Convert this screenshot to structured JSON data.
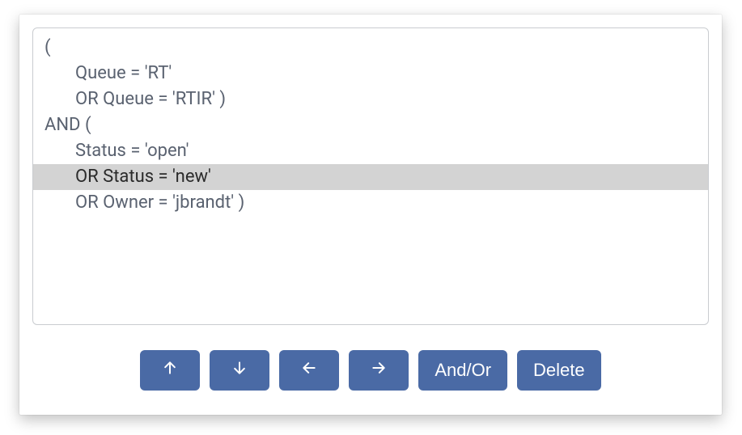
{
  "query": {
    "lines": [
      {
        "text": "(",
        "indent": 0,
        "selected": false
      },
      {
        "text": "Queue = 'RT'",
        "indent": 1,
        "selected": false
      },
      {
        "text": "OR Queue = 'RTIR' )",
        "indent": 1,
        "selected": false
      },
      {
        "text": "AND (",
        "indent": 0,
        "selected": false
      },
      {
        "text": "Status = 'open'",
        "indent": 1,
        "selected": false
      },
      {
        "text": "OR Status = 'new'",
        "indent": 1,
        "selected": true
      },
      {
        "text": "OR Owner = 'jbrandt' )",
        "indent": 1,
        "selected": false
      }
    ]
  },
  "toolbar": {
    "move_up_label": "↑",
    "move_down_label": "↓",
    "move_left_label": "←",
    "move_right_label": "→",
    "and_or_label": "And/Or",
    "delete_label": "Delete"
  },
  "colors": {
    "button_bg": "#4a6aa5",
    "selected_bg": "#d3d3d3",
    "text": "#5a6270"
  }
}
